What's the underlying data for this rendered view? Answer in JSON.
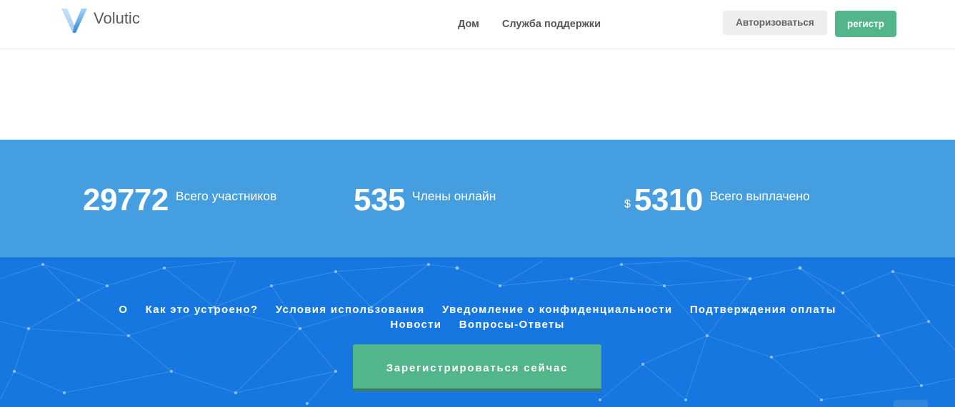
{
  "header": {
    "logo_text": "Volutic",
    "nav": [
      {
        "label": "Дом"
      },
      {
        "label": "Служба поддержки"
      }
    ],
    "login_label": "Авторизоваться",
    "register_label": "регистр"
  },
  "stats": [
    {
      "value": "29772",
      "label": "Всего участников",
      "currency": ""
    },
    {
      "value": "535",
      "label": "Члены онлайн",
      "currency": ""
    },
    {
      "value": "5310",
      "label": "Всего выплачено",
      "currency": "$"
    }
  ],
  "footer": {
    "links_row1": [
      {
        "label": "О"
      },
      {
        "label": "Как это устроено?"
      },
      {
        "label": "Условия использования"
      },
      {
        "label": "Уведомление о конфиденциальности"
      },
      {
        "label": "Подтверждения оплаты"
      }
    ],
    "links_row2": [
      {
        "label": "Новости"
      },
      {
        "label": "Вопросы-Ответы"
      }
    ],
    "cta_label": "Зарегистрироваться сейчас"
  },
  "colors": {
    "brand_green": "#53b68a",
    "stats_blue": "#449ee0",
    "footer_blue": "#1577df"
  }
}
